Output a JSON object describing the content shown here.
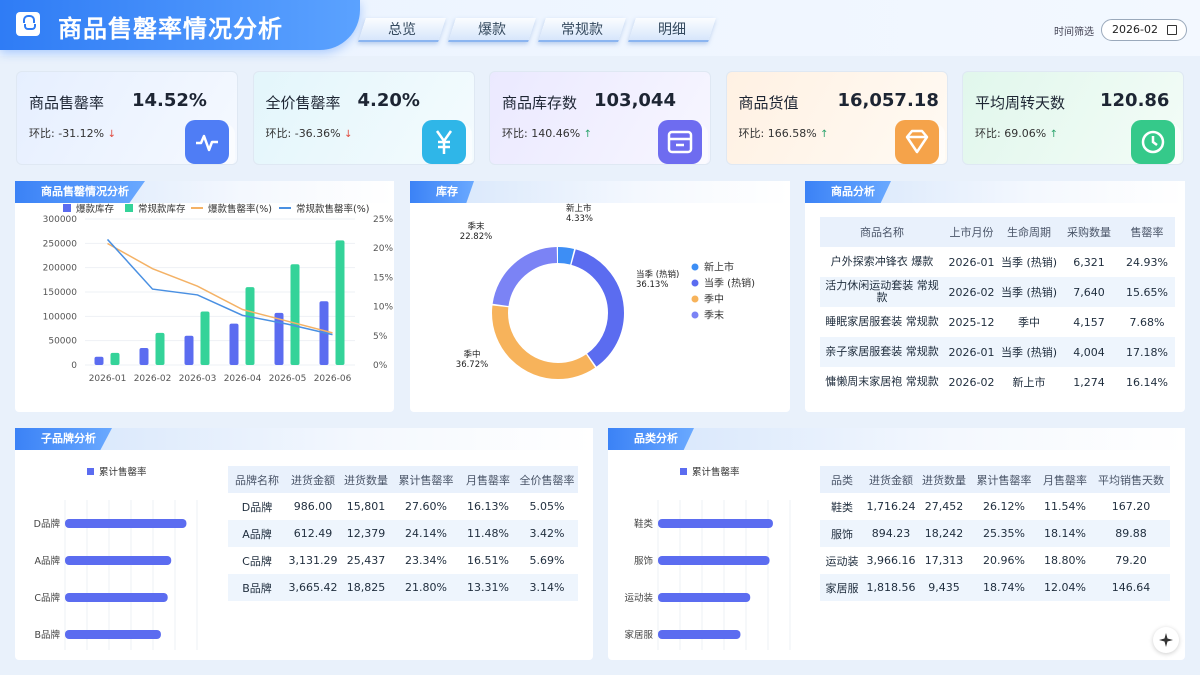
{
  "header": {
    "title": "商品售罄率情况分析",
    "tabs": [
      "总览",
      "爆款",
      "常规款",
      "明细"
    ],
    "filter_label": "时间筛选",
    "date_value": "2026-02"
  },
  "kpis": [
    {
      "label": "商品售罄率",
      "value": "14.52%",
      "change_label": "环比:",
      "change": "-31.12%",
      "direction": "down",
      "icon": "pulse-icon",
      "color": "#4f7df5"
    },
    {
      "label": "全价售罄率",
      "value": "4.20%",
      "change_label": "环比:",
      "change": "-36.36%",
      "direction": "down",
      "icon": "yuan-icon",
      "color": "#2fb6e8"
    },
    {
      "label": "商品库存数",
      "value": "103,044",
      "change_label": "环比:",
      "change": "140.46%",
      "direction": "up",
      "icon": "box-icon",
      "color": "#6e6cf0"
    },
    {
      "label": "商品货值",
      "value": "16,057.18",
      "change_label": "环比:",
      "change": "166.58%",
      "direction": "up",
      "icon": "diamond-icon",
      "color": "#f5a34a"
    },
    {
      "label": "平均周转天数",
      "value": "120.86",
      "change_label": "环比:",
      "change": "69.06%",
      "direction": "up",
      "icon": "clock-icon",
      "color": "#35c98a"
    }
  ],
  "panels": {
    "sales": "商品售罄情况分析",
    "inventory": "库存",
    "product": "商品分析",
    "brand": "子品牌分析",
    "category": "品类分析"
  },
  "chart_data": [
    {
      "type": "bar",
      "categories": [
        "2026-01",
        "2026-02",
        "2026-03",
        "2026-04",
        "2026-05",
        "2026-06"
      ],
      "series": [
        {
          "name": "爆款库存",
          "type": "bar",
          "axis": "left",
          "values": [
            17000,
            35000,
            60000,
            85000,
            107000,
            131000
          ],
          "color": "#5b6cf0"
        },
        {
          "name": "常规款库存",
          "type": "bar",
          "axis": "left",
          "values": [
            25000,
            66000,
            110000,
            160000,
            207000,
            256000
          ],
          "color": "#34d399"
        },
        {
          "name": "爆款售罄率(%)",
          "type": "line",
          "axis": "right",
          "values": [
            20.8,
            16.5,
            13.5,
            9.5,
            7.5,
            5.5
          ],
          "color": "#f4b266"
        },
        {
          "name": "常规款售罄率(%)",
          "type": "line",
          "axis": "right",
          "values": [
            21.5,
            13,
            12,
            8.5,
            7,
            5.2
          ],
          "color": "#4a90e2"
        }
      ],
      "left_ticks": [
        "300000",
        "250000",
        "200000",
        "150000",
        "100000",
        "50000",
        "0"
      ],
      "right_ticks": [
        "25%",
        "20%",
        "15%",
        "10%",
        "5%",
        "0%"
      ],
      "ylim": [
        0,
        300000
      ],
      "y2lim": [
        0,
        25
      ]
    },
    {
      "type": "pie",
      "donut": true,
      "slices": [
        {
          "name": "新上市",
          "value": 4.33,
          "label": "4.33%",
          "color": "#3d8ef5"
        },
        {
          "name": "当季 (热销)",
          "value": 36.13,
          "label": "36.13%",
          "color": "#5b6cf0"
        },
        {
          "name": "季中",
          "value": 36.72,
          "label": "36.72%",
          "color": "#f7b35b"
        },
        {
          "name": "季末",
          "value": 22.82,
          "label": "22.82%",
          "color": "#7b83f5"
        }
      ]
    },
    {
      "type": "bar",
      "orientation": "horizontal",
      "series_name": "累计售罄率",
      "categories": [
        "D品牌",
        "A品牌",
        "C品牌",
        "B品牌"
      ],
      "values": [
        27.6,
        24.14,
        23.34,
        21.8
      ],
      "xticks": [
        "0%",
        "5%",
        "10%",
        "15%",
        "20%",
        "25%",
        "30%"
      ],
      "xlim": [
        0,
        30
      ]
    },
    {
      "type": "bar",
      "orientation": "horizontal",
      "series_name": "累计售罄率",
      "categories": [
        "鞋类",
        "服饰",
        "运动装",
        "家居服"
      ],
      "values": [
        26.12,
        25.35,
        20.96,
        18.74
      ],
      "xticks": [
        "0%",
        "5%",
        "10%",
        "15%",
        "20%",
        "25%",
        "30%"
      ],
      "xlim": [
        0,
        30
      ]
    }
  ],
  "product_table": {
    "headers": [
      "商品名称",
      "上市月份",
      "生命周期",
      "采购数量",
      "售罄率"
    ],
    "rows": [
      [
        "户外探索冲锋衣 爆款",
        "2026-01",
        "当季 (热销)",
        "6,321",
        "24.93%"
      ],
      [
        "活力休闲运动套装 常规款",
        "2026-02",
        "当季 (热销)",
        "7,640",
        "15.65%"
      ],
      [
        "睡眠家居服套装 常规款",
        "2025-12",
        "季中",
        "4,157",
        "7.68%"
      ],
      [
        "亲子家居服套装 常规款",
        "2026-01",
        "当季 (热销)",
        "4,004",
        "17.18%"
      ],
      [
        "慵懒周末家居袍 常规款",
        "2026-02",
        "新上市",
        "1,274",
        "16.14%"
      ]
    ]
  },
  "brand_table": {
    "headers": [
      "品牌名称",
      "进货金额",
      "进货数量",
      "累计售罄率",
      "月售罄率",
      "全价售罄率"
    ],
    "rows": [
      [
        "D品牌",
        "986.00",
        "15,801",
        "27.60%",
        "16.13%",
        "5.05%"
      ],
      [
        "A品牌",
        "612.49",
        "12,379",
        "24.14%",
        "11.48%",
        "3.42%"
      ],
      [
        "C品牌",
        "3,131.29",
        "25,437",
        "23.34%",
        "16.51%",
        "5.69%"
      ],
      [
        "B品牌",
        "3,665.42",
        "18,825",
        "21.80%",
        "13.31%",
        "3.14%"
      ]
    ]
  },
  "category_table": {
    "headers": [
      "品类",
      "进货金额",
      "进货数量",
      "累计售罄率",
      "月售罄率",
      "平均销售天数"
    ],
    "rows": [
      [
        "鞋类",
        "1,716.24",
        "27,452",
        "26.12%",
        "11.54%",
        "167.20"
      ],
      [
        "服饰",
        "894.23",
        "18,242",
        "25.35%",
        "18.14%",
        "89.88"
      ],
      [
        "运动装",
        "3,966.16",
        "17,313",
        "20.96%",
        "18.80%",
        "79.20"
      ],
      [
        "家居服",
        "1,818.56",
        "9,435",
        "18.74%",
        "12.04%",
        "146.64"
      ]
    ]
  }
}
